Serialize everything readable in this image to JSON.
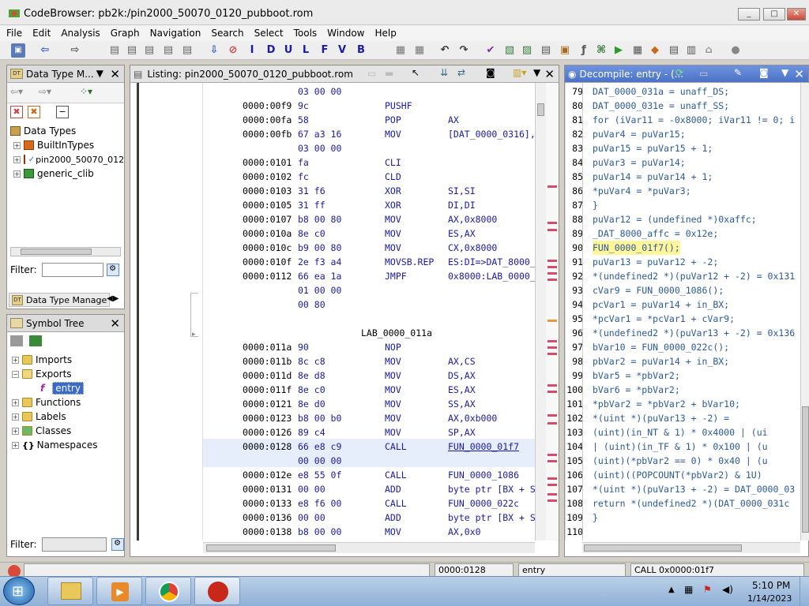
{
  "window": {
    "title": "CodeBrowser: pb2k:/pin2000_50070_0120_pubboot.rom",
    "min": "_",
    "max": "□",
    "close": "✕"
  },
  "menu": [
    "File",
    "Edit",
    "Analysis",
    "Graph",
    "Navigation",
    "Search",
    "Select",
    "Tools",
    "Window",
    "Help"
  ],
  "toolbar": {
    "letters": [
      "I",
      "D",
      "U",
      "L",
      "F",
      "V",
      "B"
    ]
  },
  "datatype_panel": {
    "title": "Data Type M...",
    "root": "Data Types",
    "items": [
      "BuiltInTypes",
      "pin2000_50070_012",
      "generic_clib"
    ],
    "filter_label": "Filter:",
    "tab_label": "Data Type Manage"
  },
  "symbol_panel": {
    "title": "Symbol Tree",
    "items": [
      {
        "label": "Imports",
        "level": 0
      },
      {
        "label": "Exports",
        "level": 0
      },
      {
        "label": "entry",
        "level": 1
      },
      {
        "label": "Functions",
        "level": 0
      },
      {
        "label": "Labels",
        "level": 0
      },
      {
        "label": "Classes",
        "level": 0
      },
      {
        "label": "Namespaces",
        "level": 0
      }
    ],
    "filter_label": "Filter:"
  },
  "listing": {
    "title": "Listing:  pin2000_50070_0120_pubboot.rom",
    "rows": [
      {
        "addr": "",
        "bytes": "03 00 00",
        "mnem": "",
        "ops": ""
      },
      {
        "addr": "0000:00f9",
        "bytes": "9c",
        "mnem": "PUSHF",
        "ops": ""
      },
      {
        "addr": "0000:00fa",
        "bytes": "58",
        "mnem": "POP",
        "ops": "AX"
      },
      {
        "addr": "0000:00fb",
        "bytes": "67 a3 16",
        "mnem": "MOV",
        "ops": "[DAT_0000_0316],"
      },
      {
        "addr": "",
        "bytes": "03 00 00",
        "mnem": "",
        "ops": ""
      },
      {
        "addr": "0000:0101",
        "bytes": "fa",
        "mnem": "CLI",
        "ops": ""
      },
      {
        "addr": "0000:0102",
        "bytes": "fc",
        "mnem": "CLD",
        "ops": ""
      },
      {
        "addr": "0000:0103",
        "bytes": "31 f6",
        "mnem": "XOR",
        "ops": "SI,SI"
      },
      {
        "addr": "0000:0105",
        "bytes": "31 ff",
        "mnem": "XOR",
        "ops": "DI,DI"
      },
      {
        "addr": "0000:0107",
        "bytes": "b8 00 80",
        "mnem": "MOV",
        "ops": "AX,0x8000"
      },
      {
        "addr": "0000:010a",
        "bytes": "8e c0",
        "mnem": "MOV",
        "ops": "ES,AX"
      },
      {
        "addr": "0000:010c",
        "bytes": "b9 00 80",
        "mnem": "MOV",
        "ops": "CX,0x8000"
      },
      {
        "addr": "0000:010f",
        "bytes": "2e f3 a4",
        "mnem": "MOVSB.REP",
        "ops": "ES:DI=>DAT_8000_"
      },
      {
        "addr": "0000:0112",
        "bytes": "66 ea 1a",
        "mnem": "JMPF",
        "ops": "0x8000:LAB_0000_"
      },
      {
        "addr": "",
        "bytes": "01 00 00",
        "mnem": "",
        "ops": ""
      },
      {
        "addr": "",
        "bytes": "00 80",
        "mnem": "",
        "ops": ""
      },
      {
        "addr": "",
        "bytes": "",
        "mnem": "",
        "ops": ""
      },
      {
        "addr": "",
        "bytes": "",
        "mnem": "",
        "ops": "",
        "label": "LAB_0000_011a"
      },
      {
        "addr": "0000:011a",
        "bytes": "90",
        "mnem": "NOP",
        "ops": ""
      },
      {
        "addr": "0000:011b",
        "bytes": "8c c8",
        "mnem": "MOV",
        "ops": "AX,CS"
      },
      {
        "addr": "0000:011d",
        "bytes": "8e d8",
        "mnem": "MOV",
        "ops": "DS,AX"
      },
      {
        "addr": "0000:011f",
        "bytes": "8e c0",
        "mnem": "MOV",
        "ops": "ES,AX"
      },
      {
        "addr": "0000:0121",
        "bytes": "8e d0",
        "mnem": "MOV",
        "ops": "SS,AX"
      },
      {
        "addr": "0000:0123",
        "bytes": "b8 00 b0",
        "mnem": "MOV",
        "ops": "AX,0xb000"
      },
      {
        "addr": "0000:0126",
        "bytes": "89 c4",
        "mnem": "MOV",
        "ops": "SP,AX"
      },
      {
        "addr": "0000:0128",
        "bytes": "66 e8 c9",
        "mnem": "CALL",
        "ops": "FUN_0000_01f7",
        "current": true
      },
      {
        "addr": "",
        "bytes": "00 00 00",
        "mnem": "",
        "ops": ""
      },
      {
        "addr": "0000:012e",
        "bytes": "e8 55 0f",
        "mnem": "CALL",
        "ops": "FUN_0000_1086"
      },
      {
        "addr": "0000:0131",
        "bytes": "00 00",
        "mnem": "ADD",
        "ops": "byte ptr [BX + S"
      },
      {
        "addr": "0000:0133",
        "bytes": "e8 f6 00",
        "mnem": "CALL",
        "ops": "FUN_0000_022c"
      },
      {
        "addr": "0000:0136",
        "bytes": "00 00",
        "mnem": "ADD",
        "ops": "byte ptr [BX + S"
      },
      {
        "addr": "0000:0138",
        "bytes": "b8 00 00",
        "mnem": "MOV",
        "ops": "AX,0x0"
      }
    ]
  },
  "decompile": {
    "title": "Decompile: entry - (...",
    "lines": [
      {
        "n": "79",
        "t": "  DAT_0000_031a = unaff_DS;"
      },
      {
        "n": "80",
        "t": "  DAT_0000_031e = unaff_SS;"
      },
      {
        "n": "81",
        "t": "  for (iVar11 = -0x8000; iVar11 != 0; i"
      },
      {
        "n": "82",
        "t": "    puVar4 = puVar15;"
      },
      {
        "n": "83",
        "t": "    puVar15 = puVar15 + 1;"
      },
      {
        "n": "84",
        "t": "    puVar3 = puVar14;"
      },
      {
        "n": "85",
        "t": "    puVar14 = puVar14 + 1;"
      },
      {
        "n": "86",
        "t": "    *puVar4 = *puVar3;"
      },
      {
        "n": "87",
        "t": "  }"
      },
      {
        "n": "88",
        "t": "  puVar12 = (undefined *)0xaffc;"
      },
      {
        "n": "89",
        "t": "  _DAT_8000_affc = 0x12e;"
      },
      {
        "n": "90",
        "t": "  FUN_0000_01f7();",
        "hl": true
      },
      {
        "n": "91",
        "t": "  puVar13 = puVar12 + -2;"
      },
      {
        "n": "92",
        "t": "  *(undefined2 *)(puVar12 + -2) = 0x131"
      },
      {
        "n": "93",
        "t": "  cVar9 = FUN_0000_1086();"
      },
      {
        "n": "94",
        "t": "  pcVar1 = puVar14 + in_BX;"
      },
      {
        "n": "95",
        "t": "  *pcVar1 = *pcVar1 + cVar9;"
      },
      {
        "n": "96",
        "t": "  *(undefined2 *)(puVar13 + -2) = 0x136"
      },
      {
        "n": "97",
        "t": "  bVar10 = FUN_0000_022c();"
      },
      {
        "n": "98",
        "t": "  pbVar2 = puVar14 + in_BX;"
      },
      {
        "n": "99",
        "t": "  bVar5 = *pbVar2;"
      },
      {
        "n": "100",
        "t": "  bVar6 = *pbVar2;"
      },
      {
        "n": "101",
        "t": "  *pbVar2 = *pbVar2 + bVar10;"
      },
      {
        "n": "102",
        "t": "  *(uint *)(puVar13 + -2) ="
      },
      {
        "n": "103",
        "t": "       (uint)(in_NT & 1) * 0x4000 | (ui"
      },
      {
        "n": "104",
        "t": "       | (uint)(in_TF & 1) * 0x100 | (u"
      },
      {
        "n": "105",
        "t": "       (uint)(*pbVar2 == 0) * 0x40 | (u"
      },
      {
        "n": "106",
        "t": "       (uint)((POPCOUNT(*pbVar2) & 1U)"
      },
      {
        "n": "107",
        "t": "  *(uint *)(puVar13 + -2) = DAT_0000_03"
      },
      {
        "n": "108",
        "t": "  return *(undefined2 *)(DAT_0000_031c"
      },
      {
        "n": "109",
        "t": "}"
      },
      {
        "n": "110",
        "t": ""
      }
    ]
  },
  "statusbar": {
    "address": "0000:0128",
    "function": "entry",
    "instruction": "CALL 0x0000:01f7"
  },
  "taskbar": {
    "time": "5:10 PM",
    "date": "1/14/2023"
  }
}
